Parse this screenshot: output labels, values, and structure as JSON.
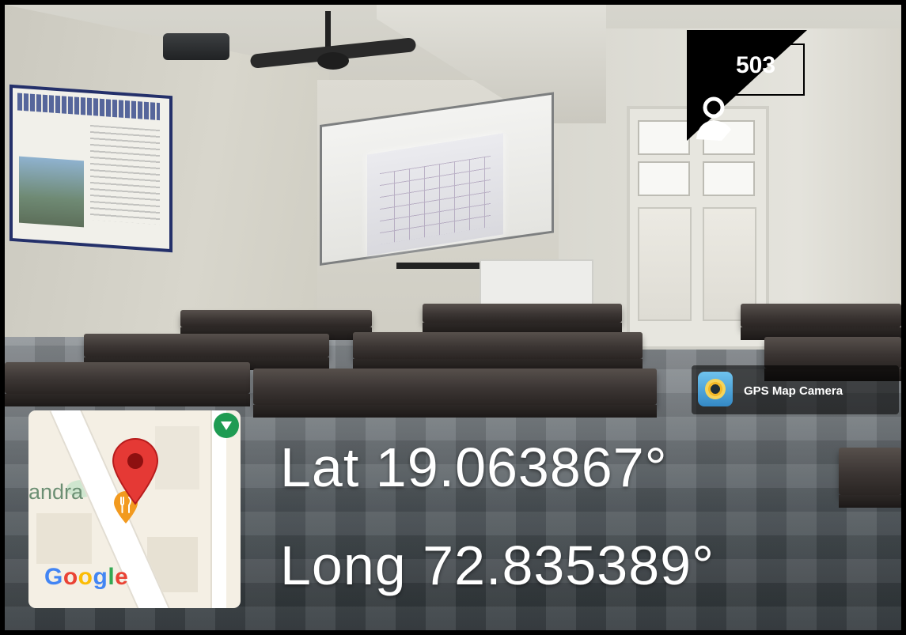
{
  "overlay": {
    "badge_value": "503",
    "latitude": "Lat 19.063867°",
    "longitude": "Long 72.835389°",
    "app_name": "GPS Map Camera",
    "app_icon": "camera-lens-icon",
    "profile_icon": "user-icon"
  },
  "map": {
    "place_fragment": "andra",
    "attribution_letters": [
      "G",
      "o",
      "o",
      "g",
      "l",
      "e"
    ],
    "pin_icon": "location-pin-icon",
    "poi_icon": "restaurant-icon",
    "corner_icon": "map-marker-icon"
  },
  "colors": {
    "pin_red": "#e53935",
    "poi_orange": "#f29a1f",
    "overlay_text": "#ffffff",
    "badge_black": "#000000"
  }
}
